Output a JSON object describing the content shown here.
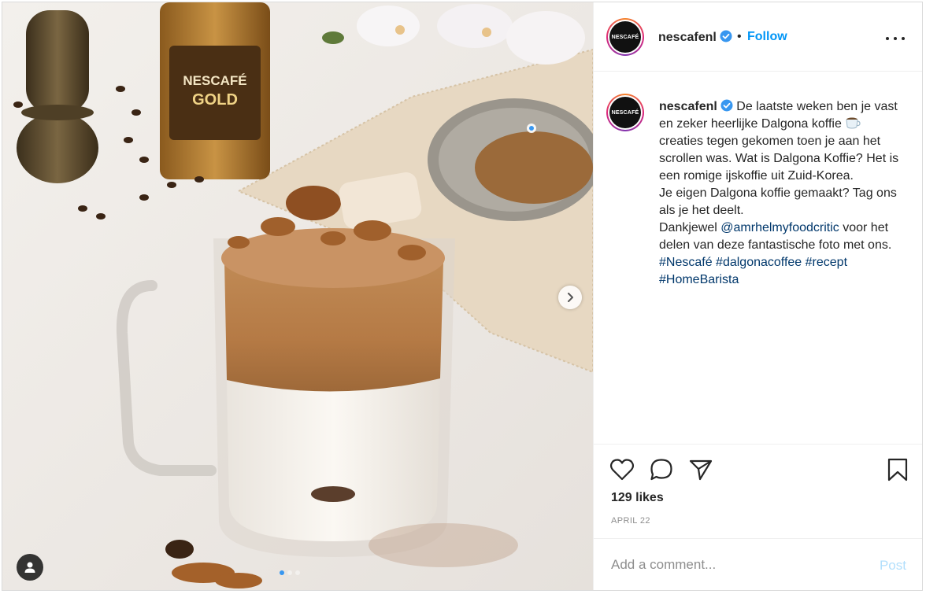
{
  "post": {
    "username": "nescafenl",
    "follow_label": "Follow",
    "separator": "•",
    "avatar_text": "NESCAFÉ",
    "caption": {
      "username": "nescafenl",
      "text_before_emoji": "De laatste weken ben je vast en zeker heerlijke Dalgona koffie",
      "text_after_emoji": "creaties tegen gekomen toen je aan het scrollen was. Wat is Dalgona Koffie? Het is een romige ijskoffie uit Zuid-Korea.",
      "line2": "Je eigen Dalgona koffie gemaakt? Tag ons als je het deelt.",
      "thanks_before": "Dankjewel",
      "mention": "@amrhelmyfoodcritic",
      "thanks_after": "voor het delen van deze fantastische foto met ons.",
      "hashtags": [
        "#Nescafé",
        "#dalgonacoffee",
        "#recept",
        "#HomeBarista"
      ]
    },
    "likes": "129 likes",
    "date": "APRIL 22",
    "comment_placeholder": "Add a comment...",
    "post_label": "Post",
    "photo_labels": {
      "jar_brand": "NESCAFÉ",
      "jar_variant": "GOLD"
    },
    "carousel": {
      "count": 3,
      "active": 0
    },
    "colors": {
      "accent": "#0095f6",
      "verified": "#3897f0",
      "post_disabled": "#b2dffc",
      "muted": "#8e8e8e"
    },
    "icons": [
      "heart-icon",
      "comment-icon",
      "share-icon",
      "bookmark-icon",
      "more-icon",
      "verified-icon",
      "next-arrow-icon",
      "user-tag-icon",
      "coffee-emoji-icon"
    ]
  }
}
